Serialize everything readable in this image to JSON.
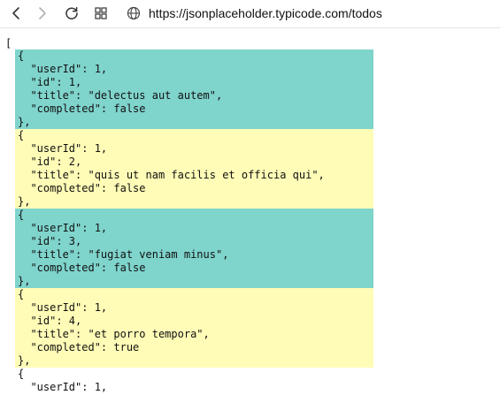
{
  "browser": {
    "url": "https://jsonplaceholder.typicode.com/todos",
    "icons": {
      "back": "back-arrow-icon",
      "forward": "forward-arrow-icon",
      "reload": "reload-icon",
      "tabs": "tabs-grid-icon",
      "site": "globe-icon"
    }
  },
  "colors": {
    "highlight_teal": "#7fd4cc",
    "highlight_yellow": "#fffcb7"
  },
  "json_view": {
    "open_bracket": "[",
    "blocks": [
      {
        "lines": [
          "{",
          "  \"userId\": 1,",
          "  \"id\": 1,",
          "  \"title\": \"delectus aut autem\",",
          "  \"completed\": false",
          "},"
        ]
      },
      {
        "lines": [
          "{",
          "  \"userId\": 1,",
          "  \"id\": 2,",
          "  \"title\": \"quis ut nam facilis et officia qui\",",
          "  \"completed\": false",
          "},"
        ]
      },
      {
        "lines": [
          "{",
          "  \"userId\": 1,",
          "  \"id\": 3,",
          "  \"title\": \"fugiat veniam minus\",",
          "  \"completed\": false",
          "},"
        ]
      },
      {
        "lines": [
          "{",
          "  \"userId\": 1,",
          "  \"id\": 4,",
          "  \"title\": \"et porro tempora\",",
          "  \"completed\": true",
          "},"
        ]
      }
    ],
    "tail_lines": [
      "{",
      "  \"userId\": 1,"
    ]
  }
}
